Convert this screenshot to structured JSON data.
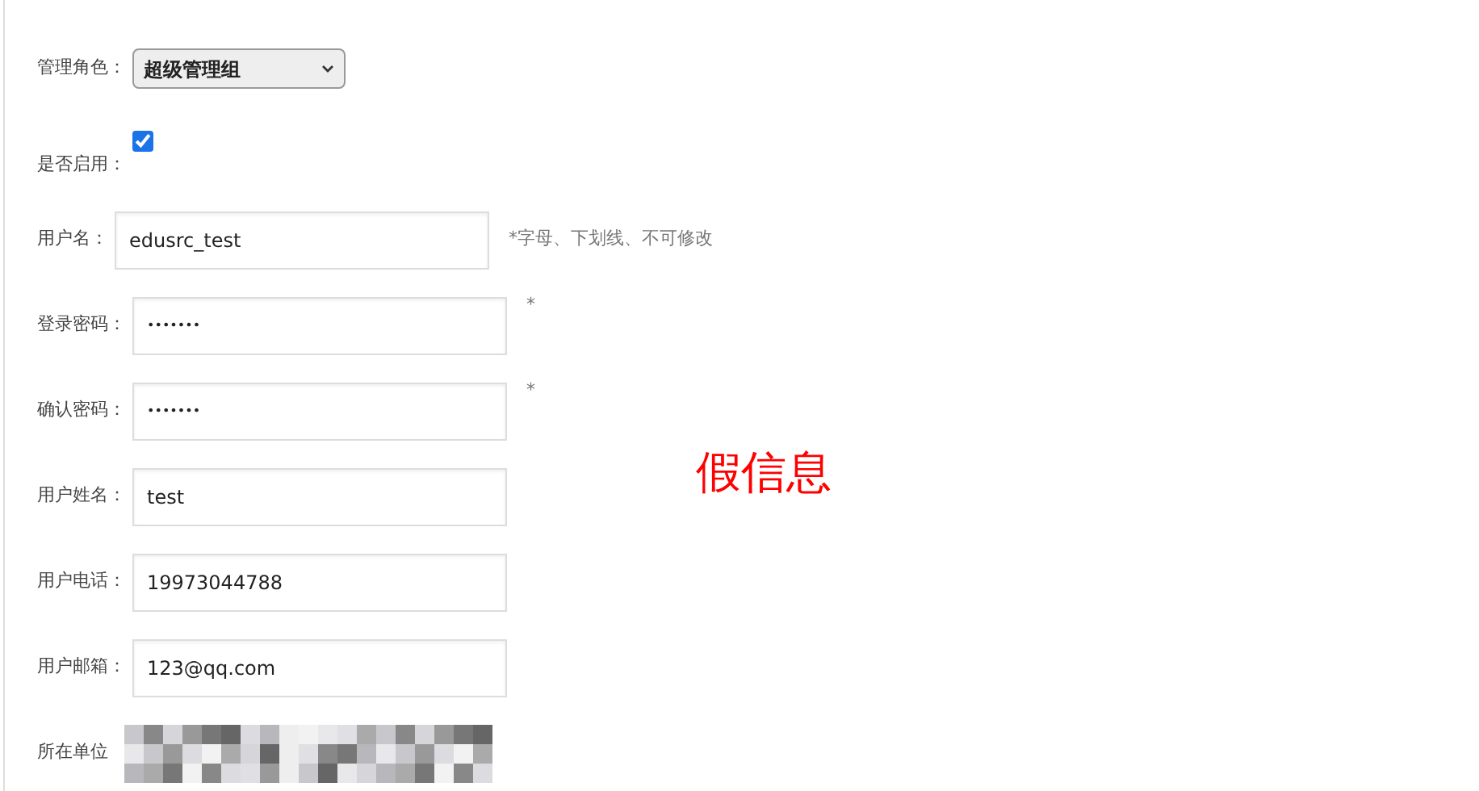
{
  "form": {
    "fields": [
      {
        "kind": "select",
        "label": "管理角色：",
        "value": "超级管理组"
      },
      {
        "kind": "checkbox",
        "label": "是否启用：",
        "checked": true
      },
      {
        "kind": "text",
        "label": "用户名：",
        "value": "edusrc_test",
        "hint": "*字母、下划线、不可修改"
      },
      {
        "kind": "text",
        "label": "登录密码：",
        "value": "•••••••",
        "hint": "*"
      },
      {
        "kind": "text",
        "label": "确认密码：",
        "value": "•••••••",
        "hint": "*"
      },
      {
        "kind": "text",
        "label": "用户姓名：",
        "value": "test"
      },
      {
        "kind": "text",
        "label": "用户电话：",
        "value": "19973044788"
      },
      {
        "kind": "text",
        "label": "用户邮箱：",
        "value": "123@qq.com"
      },
      {
        "kind": "redacted",
        "label": "所在单位"
      }
    ]
  },
  "annotation": "假信息"
}
